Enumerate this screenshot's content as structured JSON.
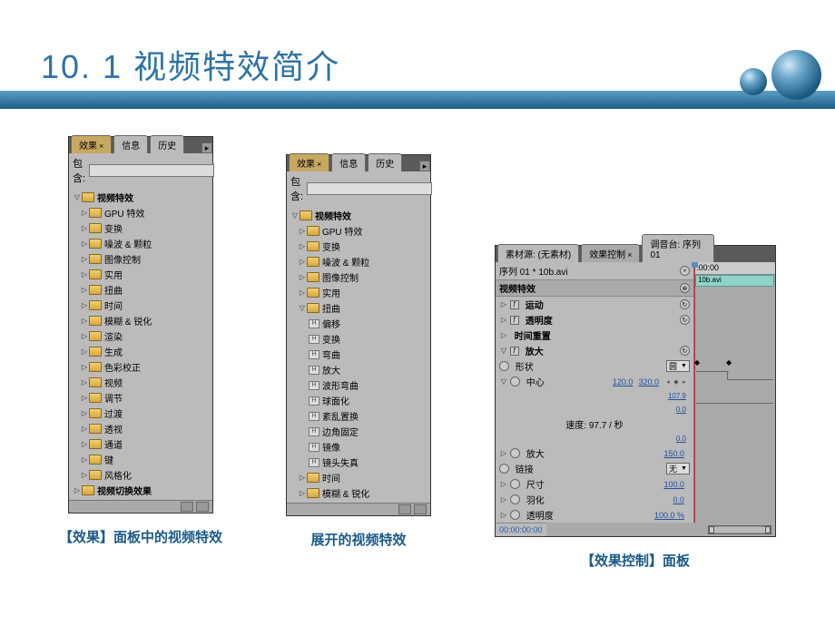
{
  "header": {
    "title_num": "10. 1",
    "title_text": "视频特效简介"
  },
  "panel1": {
    "tabs": [
      "效果",
      "信息",
      "历史"
    ],
    "search_label": "包含:",
    "root": "视频特效",
    "folders": [
      "GPU 特效",
      "变换",
      "噪波 & 颗粒",
      "图像控制",
      "实用",
      "扭曲",
      "时间",
      "模糊 & 锐化",
      "渲染",
      "生成",
      "色彩校正",
      "视频",
      "调节",
      "过渡",
      "透视",
      "通道",
      "键",
      "风格化"
    ],
    "last": "视频切换效果",
    "caption": "【效果】面板中的视频特效"
  },
  "panel2": {
    "tabs": [
      "效果",
      "信息",
      "历史"
    ],
    "search_label": "包含:",
    "root": "视频特效",
    "folders_top": [
      "GPU 特效",
      "变换",
      "噪波 & 颗粒",
      "图像控制",
      "实用"
    ],
    "open_folder": "扭曲",
    "effects": [
      "偏移",
      "变换",
      "弯曲",
      "放大",
      "波形弯曲",
      "球面化",
      "紊乱置换",
      "边角固定",
      "镜像",
      "镜头失真"
    ],
    "folders_bottom": [
      "时间",
      "模糊 & 锐化"
    ],
    "caption": "展开的视频特效"
  },
  "panel3": {
    "tabs": [
      "素材源: (无素材)",
      "效果控制",
      "调音台: 序列 01"
    ],
    "sequence": "序列 01 * 10b.avi",
    "timecode_head": ":00:00",
    "clip_name": "10b.avi",
    "section_header": "视频特效",
    "sections": {
      "motion": "运动",
      "opacity": "透明度",
      "time_remap": "时间重置",
      "magnify": "放大"
    },
    "props": {
      "shape_label": "形状",
      "shape_value": "圆",
      "center_label": "中心",
      "center_x": "120.0",
      "center_y": "320.0",
      "small1": "107.9",
      "small2": "0.0",
      "speed_label": "速度: 97.7 / 秒",
      "speed_val": "0.0",
      "magnify_label": "放大",
      "magnify_val": "150.0",
      "link_label": "链接",
      "link_val": "无",
      "size_label": "尺寸",
      "size_val": "100.0",
      "feather_label": "羽化",
      "feather_val": "0.0",
      "opacity_label": "透明度",
      "opacity_val": "100.0 %"
    },
    "timecode": "00:00:00:00",
    "caption": "【效果控制】面板"
  }
}
